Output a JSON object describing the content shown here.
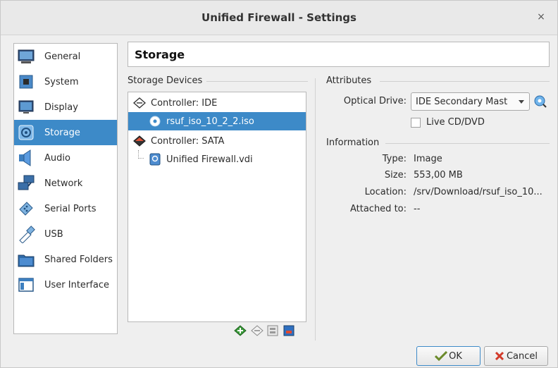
{
  "window": {
    "title": "Unified Firewall - Settings",
    "close_glyph": "×"
  },
  "sidebar": {
    "items": [
      {
        "label": "General",
        "icon": "general-icon"
      },
      {
        "label": "System",
        "icon": "system-chip-icon"
      },
      {
        "label": "Display",
        "icon": "display-icon"
      },
      {
        "label": "Storage",
        "icon": "storage-disk-icon",
        "active": true
      },
      {
        "label": "Audio",
        "icon": "audio-speaker-icon"
      },
      {
        "label": "Network",
        "icon": "network-icon"
      },
      {
        "label": "Serial Ports",
        "icon": "serial-port-icon"
      },
      {
        "label": "USB",
        "icon": "usb-icon"
      },
      {
        "label": "Shared Folders",
        "icon": "folder-icon"
      },
      {
        "label": "User Interface",
        "icon": "user-interface-icon"
      }
    ]
  },
  "header": {
    "title": "Storage"
  },
  "storage_devices": {
    "group_label": "Storage Devices",
    "tree": [
      {
        "label": "Controller: IDE",
        "level": 0,
        "icon": "ide-controller-icon"
      },
      {
        "label": "rsuf_iso_10_2_2.iso",
        "level": 1,
        "icon": "optical-disc-icon",
        "selected": true
      },
      {
        "label": "Controller: SATA",
        "level": 0,
        "icon": "sata-controller-icon"
      },
      {
        "label": "Unified Firewall.vdi",
        "level": 1,
        "icon": "hard-disk-icon"
      }
    ],
    "toolbar": [
      "add-controller-icon",
      "remove-controller-icon",
      "add-attachment-icon",
      "remove-attachment-icon"
    ]
  },
  "attributes": {
    "group_label": "Attributes",
    "optical_drive_label": "Optical Drive:",
    "optical_drive_value": "IDE Secondary Mast",
    "live_cd_label": "Live CD/DVD",
    "live_cd_checked": false
  },
  "information": {
    "group_label": "Information",
    "rows": [
      {
        "label": "Type:",
        "value": "Image"
      },
      {
        "label": "Size:",
        "value": "553,00 MB"
      },
      {
        "label": "Location:",
        "value": "/srv/Download/rsuf_iso_10..."
      },
      {
        "label": "Attached to:",
        "value": "--"
      }
    ]
  },
  "buttons": {
    "ok": "OK",
    "cancel": "Cancel"
  },
  "colors": {
    "selection": "#3d8ac8",
    "accent_green": "#3a9a3a",
    "accent_red": "#d23a2a"
  }
}
